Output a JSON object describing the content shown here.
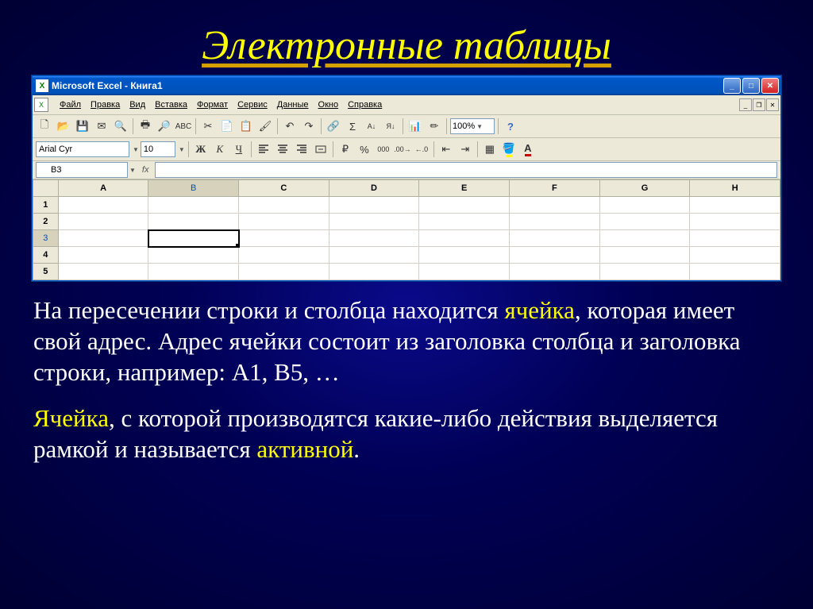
{
  "slide": {
    "title": "Электронные таблицы"
  },
  "window": {
    "title": "Microsoft Excel - Книга1"
  },
  "menus": {
    "file": "Файл",
    "edit": "Правка",
    "view": "Вид",
    "insert": "Вставка",
    "format": "Формат",
    "tools": "Сервис",
    "data": "Данные",
    "window": "Окно",
    "help": "Справка"
  },
  "toolbar": {
    "zoom": "100%"
  },
  "format": {
    "font": "Arial Cyr",
    "size": "10",
    "bold": "Ж",
    "italic": "К",
    "underline": "Ч"
  },
  "formulabar": {
    "name_box": "B3",
    "fx": "fx"
  },
  "grid": {
    "columns": [
      "A",
      "B",
      "C",
      "D",
      "E",
      "F",
      "G",
      "H"
    ],
    "rows": [
      "1",
      "2",
      "3",
      "4",
      "5"
    ],
    "active_col": "B",
    "active_row": "3"
  },
  "text": {
    "p1_a": "На пересечении строки и столбца находится ",
    "p1_cell": "ячейка",
    "p1_b": ", которая имеет свой адрес. Адрес ячейки состоит из заголовка столбца  и заголовка строки, например: А1, В5, …",
    "p2_cell": "Ячейка",
    "p2_a": ",  с которой производятся какие-либо действия выделяется рамкой и называется ",
    "p2_active": "активной",
    "p2_b": "."
  }
}
